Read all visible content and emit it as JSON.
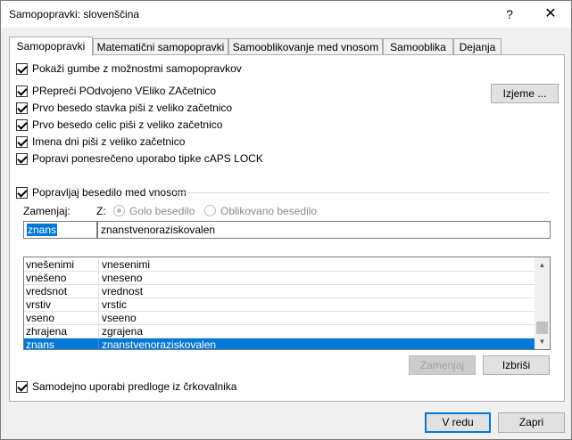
{
  "window": {
    "title": "Samopopravki: slovenščina",
    "help_glyph": "?",
    "close_glyph": "✕"
  },
  "tabs": [
    {
      "label": "Samopopravki",
      "active": true
    },
    {
      "label": "Matematični samopopravki",
      "active": false
    },
    {
      "label": "Samooblikovanje med vnosom",
      "active": false
    },
    {
      "label": "Samooblika",
      "active": false
    },
    {
      "label": "Dejanja",
      "active": false
    }
  ],
  "options": {
    "show_buttons": "Pokaži gumbe z možnostmi samopopravkov",
    "two_initial_caps": "PRepreči POdvojeno VEliko ZAčetnico",
    "capitalize_sentence": "Prvo besedo stavka piši z veliko začetnico",
    "capitalize_cell": "Prvo besedo celic piši z veliko začetnico",
    "capitalize_days": "Imena dni piši z veliko začetnico",
    "caps_lock": "Popravi ponesrečeno uporabo tipke cAPS LOCK",
    "replace_as_you_type": "Popravljaj besedilo med vnosom",
    "use_spelling": "Samodejno uporabi predloge iz črkovalnika"
  },
  "buttons": {
    "exceptions": "Izjeme ...",
    "replace": "Zamenjaj",
    "delete": "Izbriši",
    "ok": "V redu",
    "cancel": "Zapri"
  },
  "replace_section": {
    "replace_label": "Zamenjaj:",
    "with_label": "Z:",
    "plain_text": "Golo besedilo",
    "formatted_text": "Oblikovano besedilo",
    "replace_value": "znans",
    "with_value": "znanstvenoraziskovalen"
  },
  "list": {
    "rows": [
      {
        "from": "vnešenimi",
        "to": "vnesenimi"
      },
      {
        "from": "vnešeno",
        "to": "vneseno"
      },
      {
        "from": "vredsnot",
        "to": "vrednost"
      },
      {
        "from": "vrstiv",
        "to": "vrstic"
      },
      {
        "from": "vseno",
        "to": "vseeno"
      },
      {
        "from": "zhrajena",
        "to": "zgrajena"
      },
      {
        "from": "znans",
        "to": "znanstvenoraziskovalen"
      }
    ],
    "selected_index": 6
  }
}
